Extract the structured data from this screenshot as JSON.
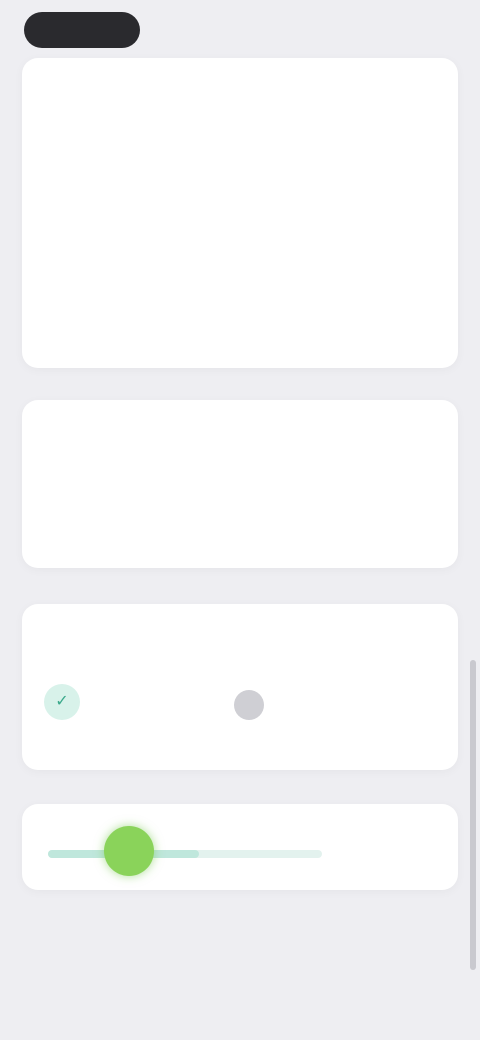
{
  "header": {
    "back_label": "",
    "right_label": ""
  },
  "calendar": {
    "month": "",
    "year": "",
    "action_label": "",
    "weekdays": [
      "",
      "",
      "",
      "",
      "",
      "",
      ""
    ],
    "days": [
      "",
      "",
      "",
      "",
      "",
      "",
      "",
      "",
      "",
      "",
      "",
      "",
      "",
      "",
      "",
      "",
      "",
      "",
      "",
      "",
      "",
      "",
      "",
      "",
      "",
      "",
      "",
      "",
      ""
    ]
  },
  "summary": {
    "title": "",
    "left": {
      "value": "",
      "unit": "",
      "sub": ""
    },
    "right": {
      "value": "",
      "unit": "",
      "sub": ""
    }
  },
  "completion": {
    "title": "",
    "item_label": "",
    "item_sub": "",
    "badge": ""
  },
  "progress_card": {
    "title": "",
    "subtitle": "",
    "fill": 0.55
  },
  "footer": {
    "link_label": ""
  },
  "colors": {
    "accent": "#58b8a2",
    "progress_green": "#8ad35a",
    "background": "#eeeef2"
  }
}
